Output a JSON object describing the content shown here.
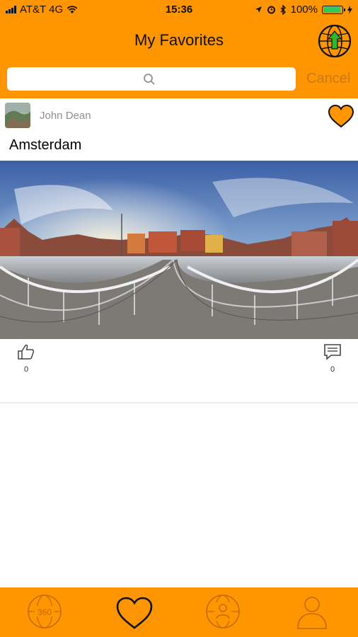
{
  "status_bar": {
    "carrier": "AT&T 4G",
    "time": "15:36",
    "battery": "100%",
    "battery_level": 1.0
  },
  "header": {
    "title": "My Favorites",
    "upload_icon": "globe-upload-icon"
  },
  "search": {
    "placeholder": "",
    "value": "",
    "cancel_label": "Cancel"
  },
  "post": {
    "author": "John Dean",
    "caption": "Amsterdam",
    "likes": "0",
    "comments": "0",
    "favorited": true
  },
  "tab_bar": {
    "items": [
      {
        "icon": "360-globe-icon",
        "label": "360"
      },
      {
        "icon": "heart-icon",
        "active": true
      },
      {
        "icon": "globe-person-icon"
      },
      {
        "icon": "profile-icon"
      }
    ]
  },
  "colors": {
    "accent": "#ff9500",
    "cancel": "#c97a1a",
    "battery": "#34c759",
    "upload_arrow": "#2eb82e"
  }
}
